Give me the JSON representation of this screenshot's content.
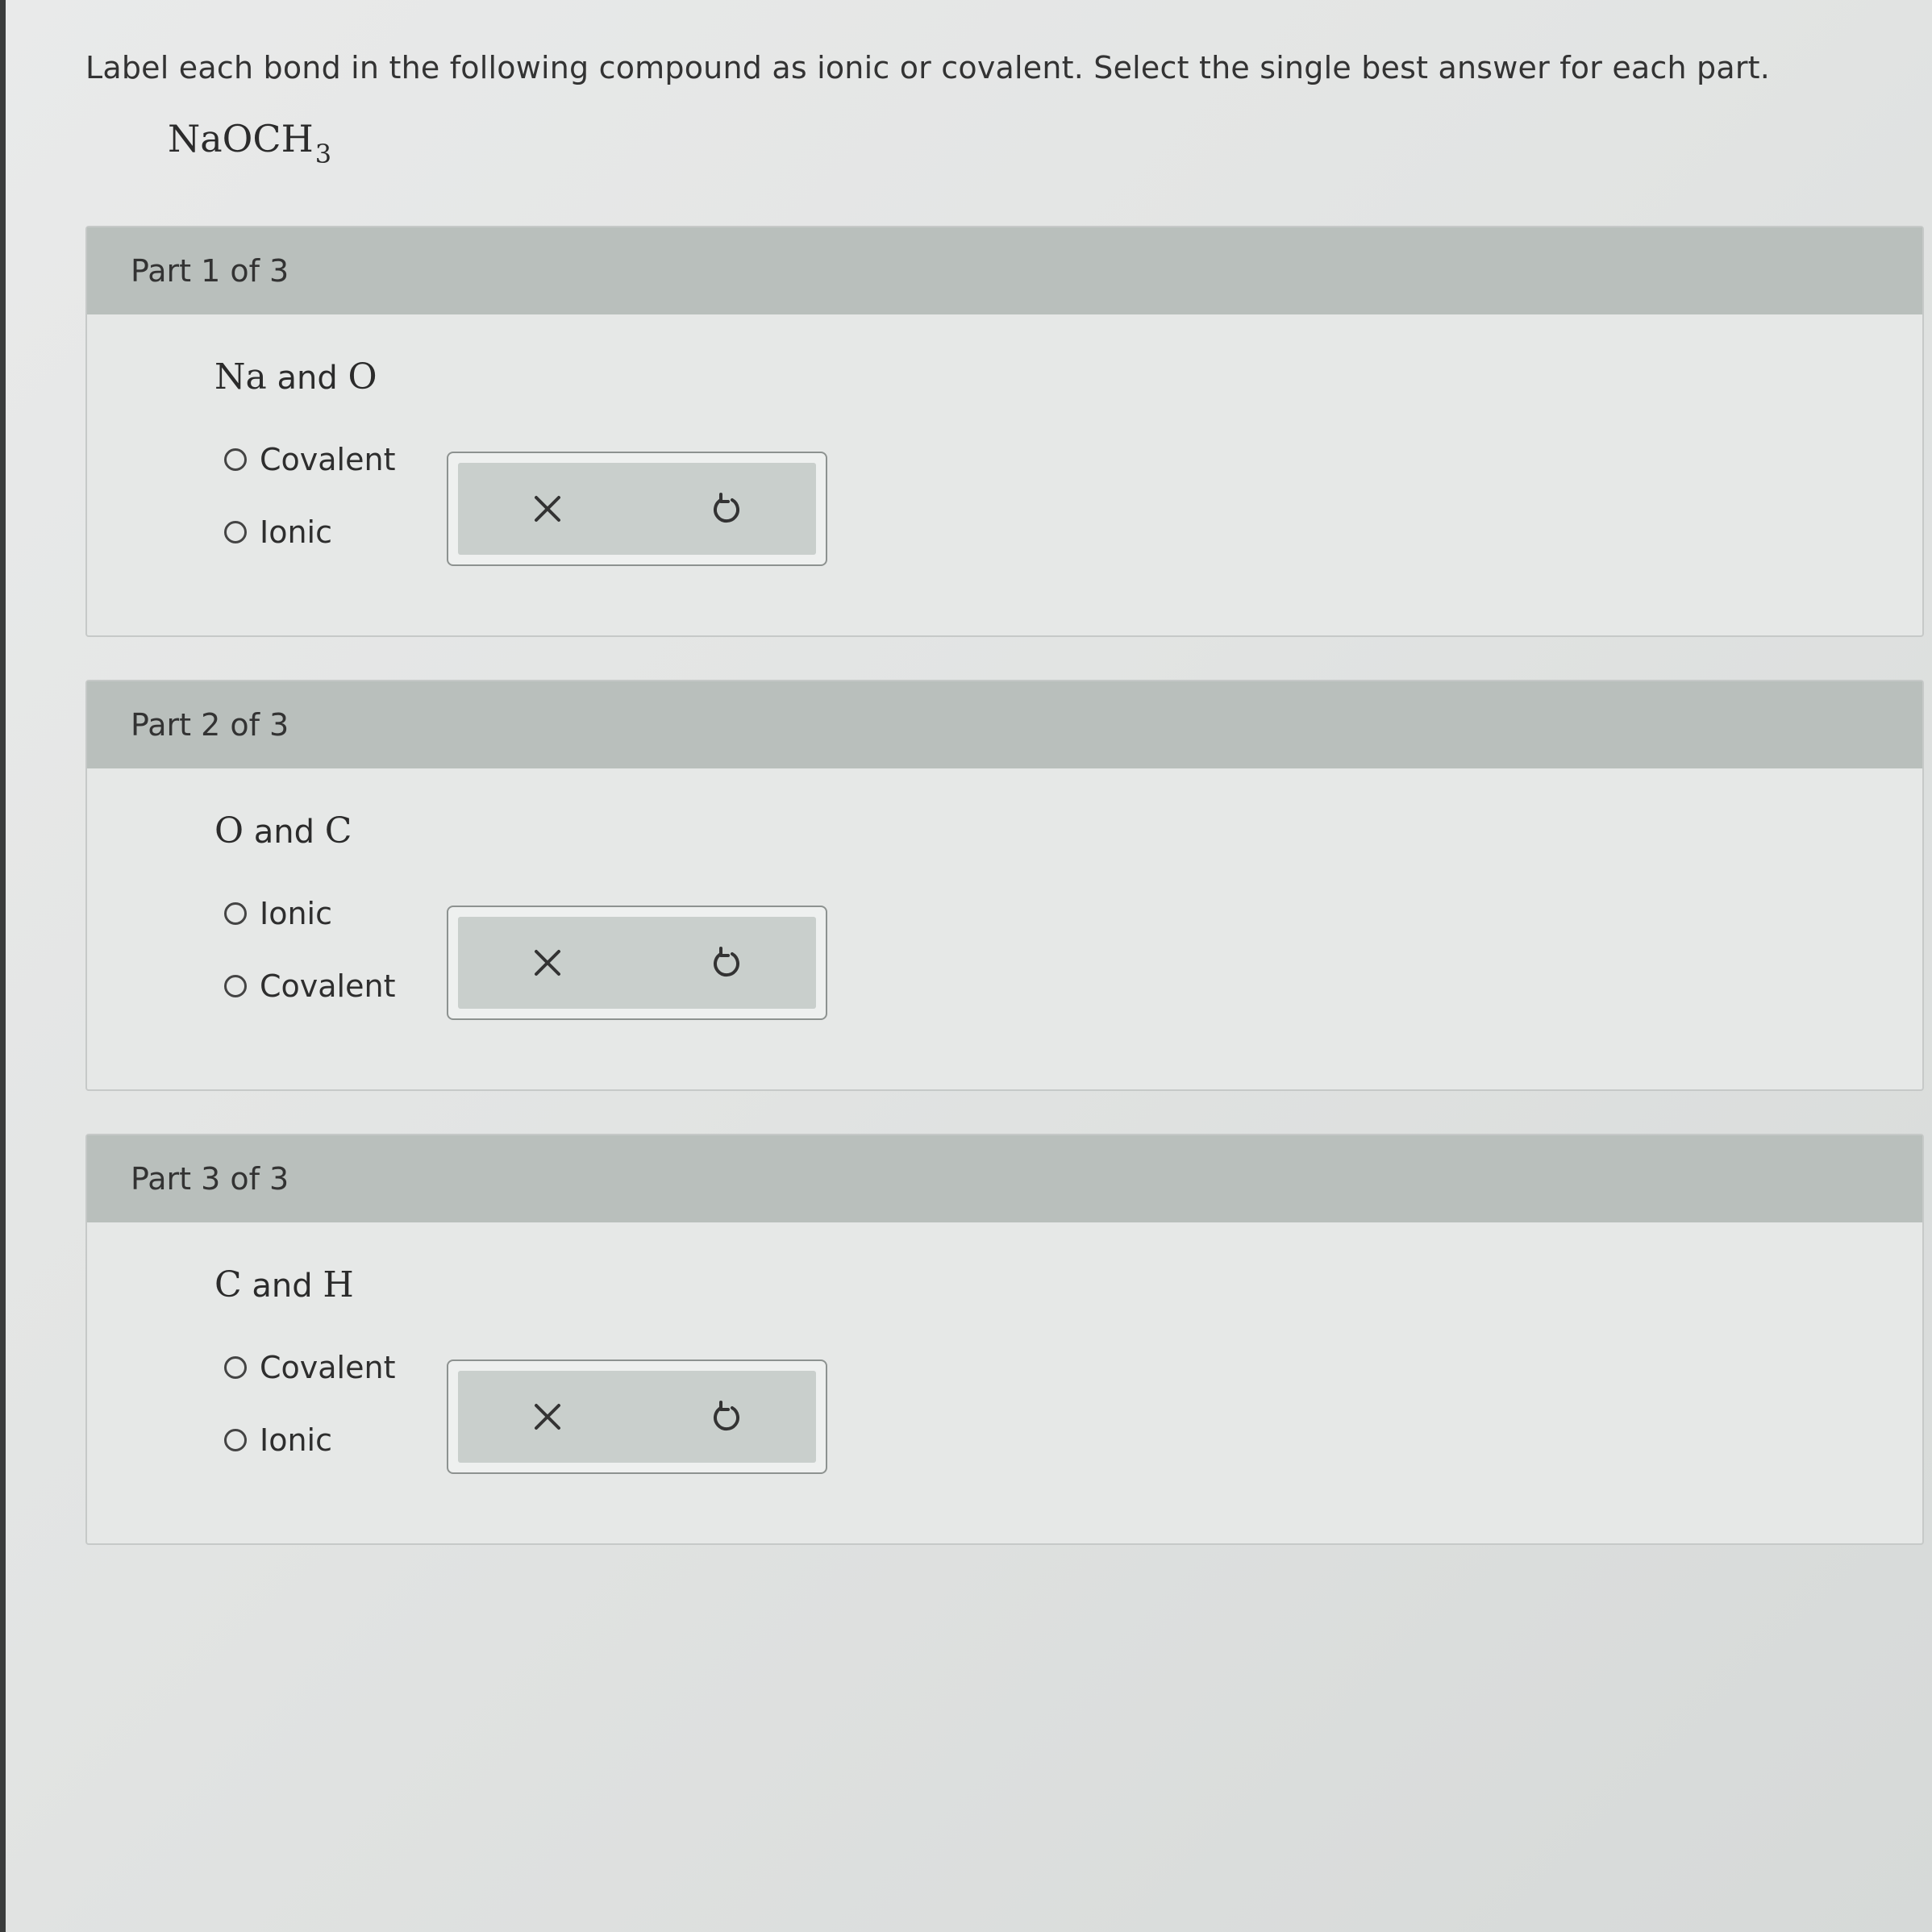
{
  "prompt": "Label each bond in the following compound as ionic or covalent. Select the single best answer for each part.",
  "compound": {
    "main": "NaOCH",
    "subscript": "3"
  },
  "parts": [
    {
      "title": "Part 1 of 3",
      "bond": {
        "el1": "Na",
        "conj": "and",
        "el2": "O"
      },
      "options": [
        "Covalent",
        "Ionic"
      ]
    },
    {
      "title": "Part 2 of 3",
      "bond": {
        "el1": "O",
        "conj": "and",
        "el2": "C"
      },
      "options": [
        "Ionic",
        "Covalent"
      ]
    },
    {
      "title": "Part 3 of 3",
      "bond": {
        "el1": "C",
        "conj": "and",
        "el2": "H"
      },
      "options": [
        "Covalent",
        "Ionic"
      ]
    }
  ],
  "icons": {
    "clear": "close-icon",
    "reset": "undo-icon"
  }
}
